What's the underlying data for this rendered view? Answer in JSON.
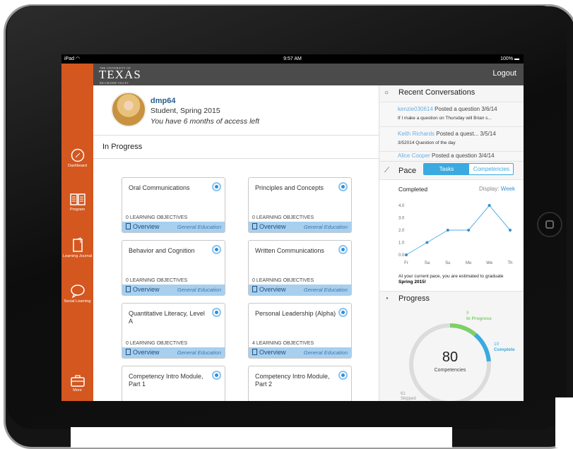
{
  "status_bar": {
    "device": "iPad",
    "time": "9:57 AM",
    "battery": "100%"
  },
  "header": {
    "logo_small": "THE UNIVERSITY OF",
    "logo_big": "TEXAS",
    "logo_sub": "RIO GRANDE VALLEY",
    "logout": "Logout"
  },
  "sidebar": {
    "items": [
      {
        "label": "Dashboard",
        "icon": "compass-icon"
      },
      {
        "label": "Program",
        "icon": "book-icon"
      },
      {
        "label": "Learning Journal",
        "icon": "journal-icon"
      },
      {
        "label": "Social Learning",
        "icon": "chat-bubble-icon"
      },
      {
        "label": "More",
        "icon": "briefcase-icon"
      }
    ]
  },
  "profile": {
    "username": "dmp64",
    "role": "Student, Spring 2015",
    "access": "You have 6 months of access left"
  },
  "section_title": "In Progress",
  "cards": [
    {
      "title": "Oral Communications",
      "objectives": "0 LEARNING OBJECTIVES",
      "overview": "Overview",
      "category": "General Education"
    },
    {
      "title": "Principles and Concepts",
      "objectives": "0 LEARNING OBJECTIVES",
      "overview": "Overview",
      "category": "General Education"
    },
    {
      "title": "Behavior and Cognition",
      "objectives": "0 LEARNING OBJECTIVES",
      "overview": "Overview",
      "category": "General Education"
    },
    {
      "title": "Written Communications",
      "objectives": "0 LEARNING OBJECTIVES",
      "overview": "Overview",
      "category": "General Education"
    },
    {
      "title": "Quantitative Literacy, Level A",
      "objectives": "0 LEARNING OBJECTIVES",
      "overview": "Overview",
      "category": "General Education"
    },
    {
      "title": "Personal Leadership (Alpha)",
      "objectives": "4 LEARNING OBJECTIVES",
      "overview": "Overview",
      "category": "General Education"
    },
    {
      "title": "Competency Intro Module, Part 1",
      "objectives": "",
      "overview": "",
      "category": ""
    },
    {
      "title": "Competency Intro Module, Part 2",
      "objectives": "",
      "overview": "",
      "category": ""
    }
  ],
  "conversations": {
    "title": "Recent Conversations",
    "items": [
      {
        "name": "kenzie030614",
        "action": "Posted a question",
        "date": "3/6/14",
        "text": "If I make a question on Thursday will Brian s..."
      },
      {
        "name": "Keith Richards",
        "action": "Posted a quest...",
        "date": "3/5/14",
        "text": "3/52014 Question of the day"
      },
      {
        "name": "Alice Cooper",
        "action": "Posted a question",
        "date": "3/4/14",
        "text": ""
      }
    ]
  },
  "pace": {
    "title": "Pace",
    "tabs": [
      "Tasks",
      "Competencies"
    ],
    "completed_label": "Completed",
    "display_label": "Display:",
    "display_value": "Week",
    "estimate_prefix": "At your current pace, you are estimated to graduate",
    "estimate_value": "Spring 2015!"
  },
  "chart_data": {
    "type": "line",
    "categories": [
      "Fr",
      "Sa",
      "Su",
      "Mo",
      "We",
      "Th"
    ],
    "values": [
      0.0,
      1.0,
      2.0,
      2.0,
      4.0,
      2.0
    ],
    "ylim": [
      0,
      4.0
    ],
    "yticks": [
      "0.0",
      "1.0",
      "2.0",
      "3.0",
      "4.0"
    ],
    "line_color": "#5aaee6",
    "grid": false
  },
  "progress": {
    "title": "Progress",
    "total": "80",
    "total_label": "Competencies",
    "in_progress_count": "9",
    "in_progress_label": "In Progress",
    "complete_count": "10",
    "complete_label": "Complete",
    "skipped_count": "61",
    "skipped_label": "Skipped",
    "complete_fraction": 0.125,
    "in_progress_fraction": 0.1125,
    "colors": {
      "complete": "#3aaae0",
      "in_progress": "#7fcf68",
      "remaining": "#dcdcdc"
    }
  }
}
